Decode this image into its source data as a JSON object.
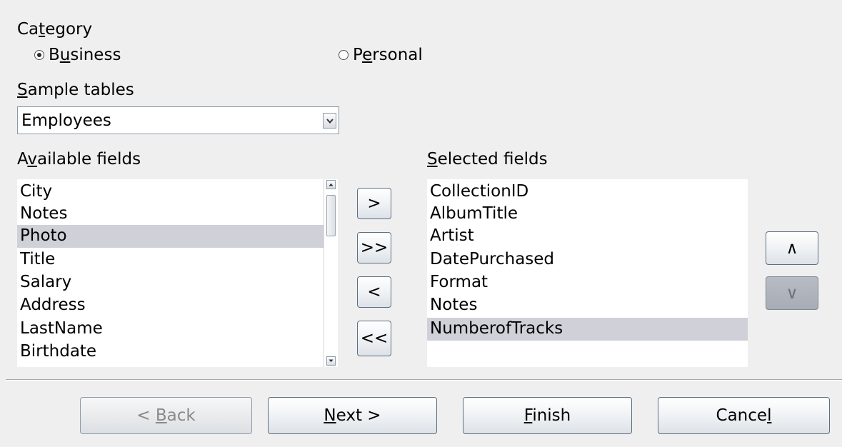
{
  "category": {
    "label_pre": "Ca",
    "label_u": "t",
    "label_post": "egory",
    "options": [
      {
        "pre": "B",
        "u": "u",
        "post": "siness",
        "selected": true
      },
      {
        "pre": "P",
        "u": "e",
        "post": "rsonal",
        "selected": false
      }
    ]
  },
  "sample_tables": {
    "label_pre": "",
    "label_u": "S",
    "label_post": "ample tables",
    "value": "Employees"
  },
  "available_fields": {
    "label_pre": "A",
    "label_u": "v",
    "label_post": "ailable fields",
    "items": [
      "City",
      "Notes",
      "Photo",
      "Title",
      "Salary",
      "Address",
      "LastName",
      "Birthdate"
    ],
    "selected_index": 2
  },
  "selected_fields": {
    "label_pre": "",
    "label_u": "S",
    "label_post": "elected fields",
    "items": [
      "CollectionID",
      "AlbumTitle",
      "Artist",
      "DatePurchased",
      "Format",
      "Notes",
      "NumberofTracks"
    ],
    "selected_index": 6
  },
  "transfer_buttons": {
    "add_one": ">",
    "add_all": ">>",
    "remove_one": "<",
    "remove_all": "<<"
  },
  "order_buttons": {
    "up": "∧",
    "down": "∨"
  },
  "footer": {
    "back": {
      "pre": "< ",
      "u": "B",
      "post": "ack"
    },
    "next": {
      "pre": "",
      "u": "N",
      "post": "ext >"
    },
    "finish": {
      "pre": "",
      "u": "F",
      "post": "inish"
    },
    "cancel": {
      "pre": "Cance",
      "u": "l",
      "post": ""
    }
  }
}
